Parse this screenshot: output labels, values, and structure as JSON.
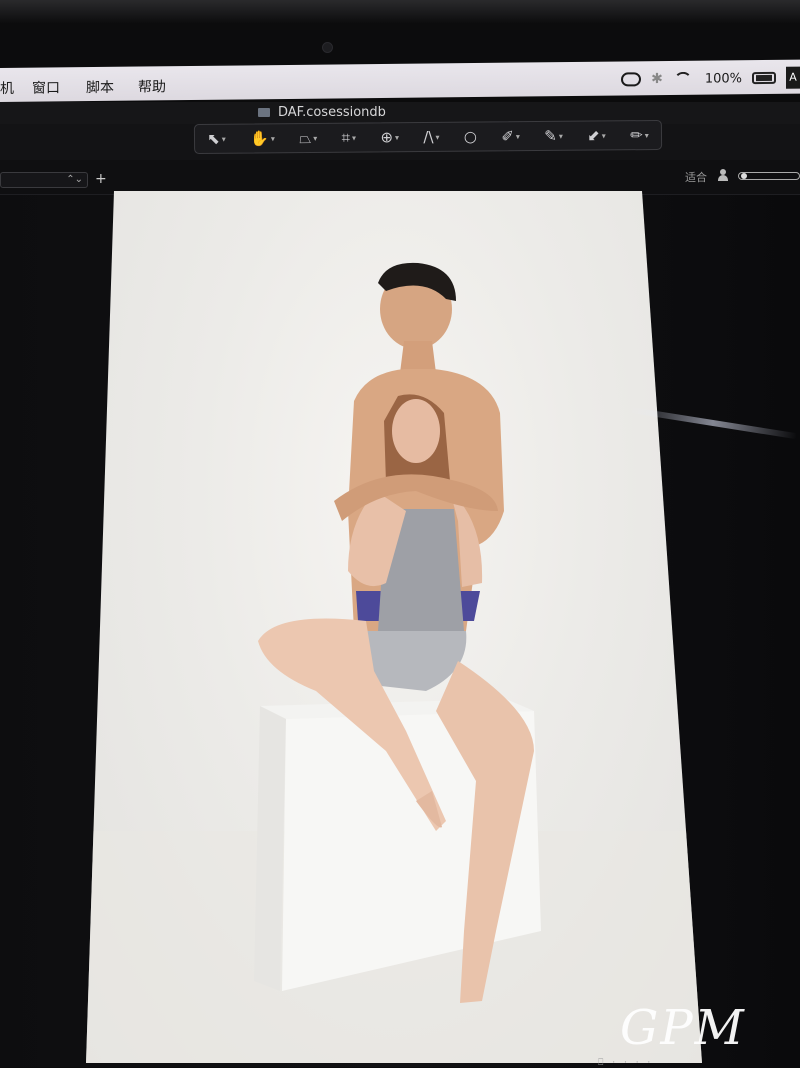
{
  "menubar": {
    "items": [
      "机",
      "窗口",
      "脚本",
      "帮助"
    ],
    "battery": "100%"
  },
  "titlebar": {
    "document_title": "DAF.cosessiondb"
  },
  "toolbar": {
    "tools": [
      {
        "name": "select-tool",
        "glyph": "⬉"
      },
      {
        "name": "pan-tool",
        "glyph": "✋"
      },
      {
        "name": "keystone-tool",
        "glyph": "⏢"
      },
      {
        "name": "crop-tool",
        "glyph": "⌗"
      },
      {
        "name": "rotate-tool",
        "glyph": "⊕"
      },
      {
        "name": "straighten-tool",
        "glyph": "/\\"
      },
      {
        "name": "circle-tool",
        "glyph": "○"
      },
      {
        "name": "picker-tool",
        "glyph": "✐"
      },
      {
        "name": "eyedropper-tool",
        "glyph": "✎"
      },
      {
        "name": "fill-tool",
        "glyph": "⬋"
      },
      {
        "name": "brush-tool",
        "glyph": "✏"
      }
    ]
  },
  "subrow": {
    "fit_label": "适合",
    "select_arrows": "⌃⌄",
    "plus_glyph": "+"
  },
  "viewer": {
    "watermark": "GPM",
    "status_ticks": "⎕ ⋅ ⋅ ⋅ ⋅"
  },
  "colors": {
    "accent_hand": "#f08a2c",
    "backdrop": "#ecebe8"
  }
}
